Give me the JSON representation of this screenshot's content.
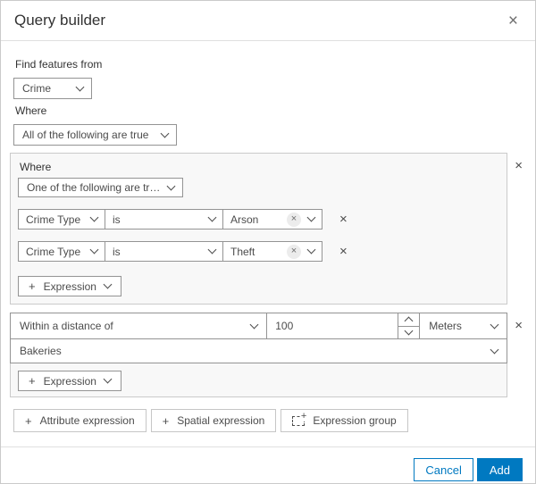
{
  "dialog": {
    "title": "Query builder"
  },
  "icons": {
    "close": "×",
    "remove": "×",
    "tag_remove": "×",
    "plus": "+"
  },
  "find_features": {
    "label": "Find features from",
    "layer": "Crime"
  },
  "where": {
    "label": "Where",
    "combine": "All of the following are true"
  },
  "group1": {
    "label": "Where",
    "combine": "One of the following are tr…",
    "rows": [
      {
        "field": "Crime Type",
        "operator": "is",
        "value": "Arson"
      },
      {
        "field": "Crime Type",
        "operator": "is",
        "value": "Theft"
      }
    ],
    "add_expression": "Expression"
  },
  "group2": {
    "mode": "Within a distance of",
    "distance": "100",
    "units": "Meters",
    "layer": "Bakeries",
    "add_expression": "Expression"
  },
  "toolbar": {
    "attribute_expression": "Attribute expression",
    "spatial_expression": "Spatial expression",
    "expression_group": "Expression group"
  },
  "footer": {
    "cancel": "Cancel",
    "add": "Add"
  },
  "colors": {
    "accent": "#0079c1",
    "control_border": "#949494",
    "group_border": "#cacaca",
    "group_background": "#f8f8f8",
    "text": "#323232"
  }
}
